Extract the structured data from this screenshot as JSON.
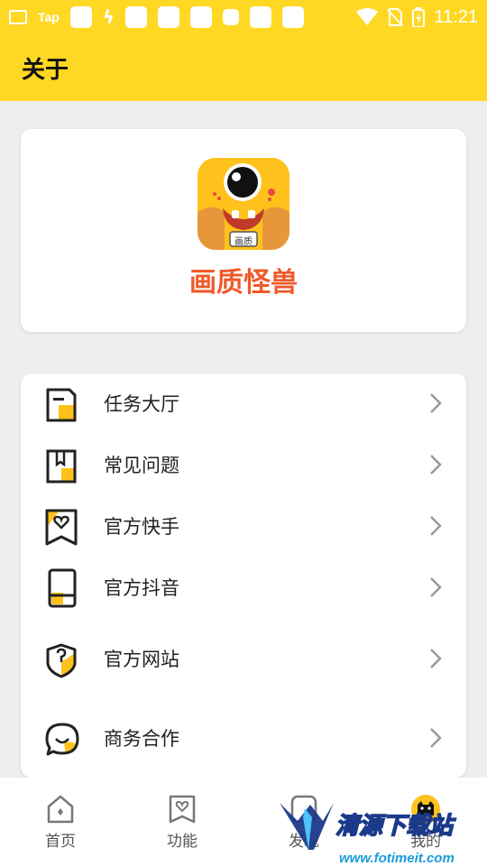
{
  "status_bar": {
    "tap_label": "Tap",
    "time": "11:21"
  },
  "header": {
    "title": "关于"
  },
  "app": {
    "name": "画质怪兽",
    "icon_badge": "画质"
  },
  "menu": {
    "items": [
      {
        "label": "任务大厅",
        "icon": "task-icon"
      },
      {
        "label": "常见问题",
        "icon": "faq-book-icon"
      },
      {
        "label": "官方快手",
        "icon": "kuaishou-heart-icon"
      },
      {
        "label": "官方抖音",
        "icon": "phone-icon"
      },
      {
        "label": "官方网站",
        "icon": "shield-icon"
      },
      {
        "label": "商务合作",
        "icon": "chat-bubble-icon"
      }
    ]
  },
  "bottom_nav": {
    "items": [
      {
        "label": "首页",
        "icon": "home-icon"
      },
      {
        "label": "功能",
        "icon": "feature-heart-icon"
      },
      {
        "label": "发现",
        "icon": "discover-icon"
      },
      {
        "label": "我的",
        "icon": "cat-avatar-icon"
      }
    ]
  },
  "watermark": {
    "title": "清源下载站",
    "url": "www.fotimeit.com"
  },
  "colors": {
    "accent": "#ffd824",
    "app_name": "#ee5a2a",
    "icon_yellow": "#ffc21c"
  }
}
